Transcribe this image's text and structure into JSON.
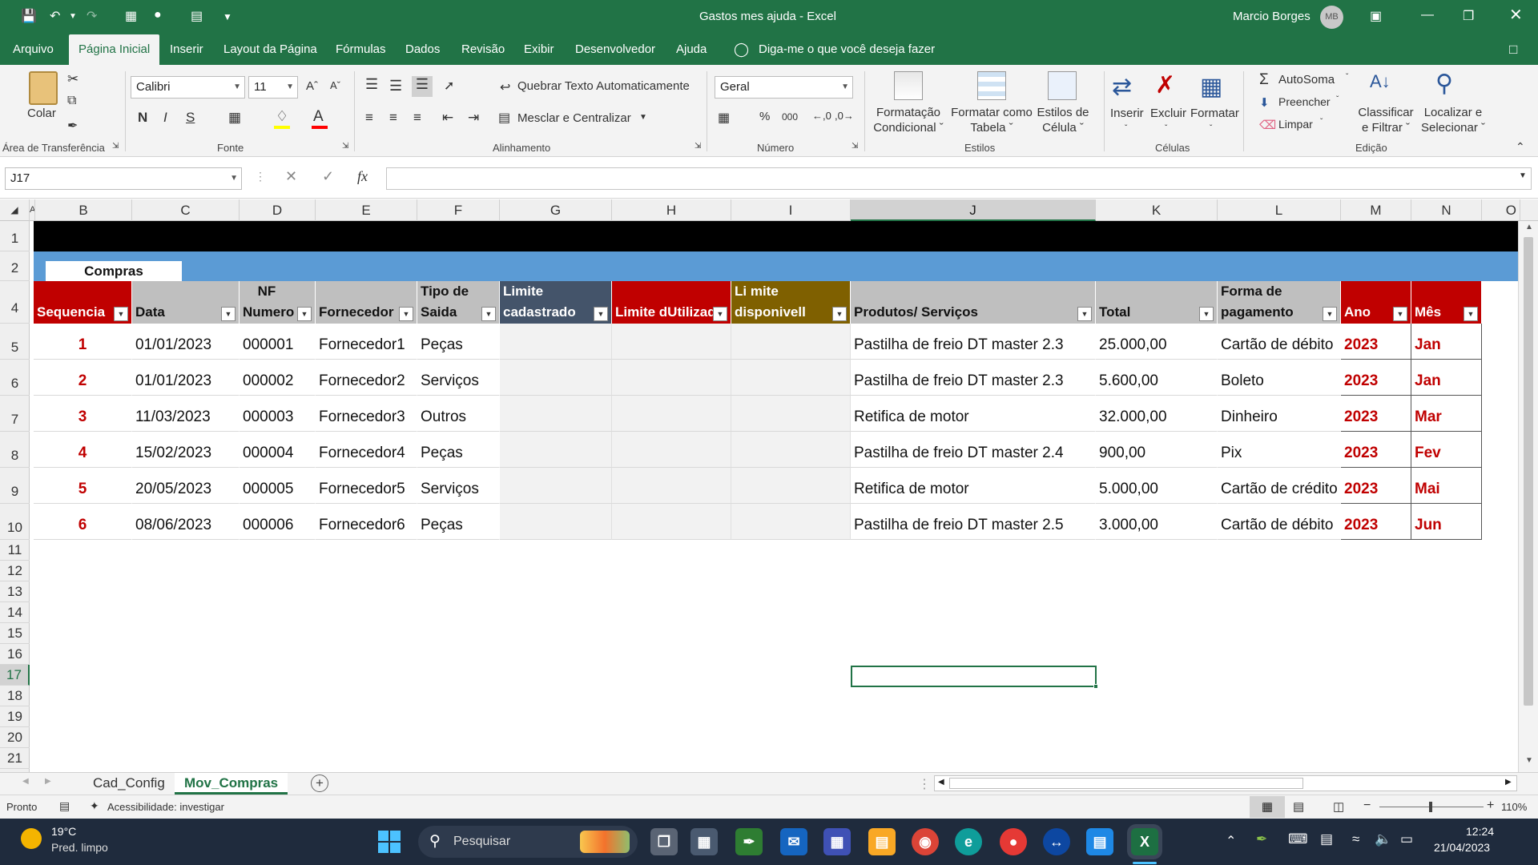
{
  "window": {
    "title": "Gastos mes ajuda  -  Excel",
    "user": "Marcio Borges",
    "user_initials": "MB"
  },
  "menu": {
    "tabs": [
      "Arquivo",
      "Página Inicial",
      "Inserir",
      "Layout da Página",
      "Fórmulas",
      "Dados",
      "Revisão",
      "Exibir",
      "Desenvolvedor",
      "Ajuda"
    ],
    "active_index": 1,
    "tell_me": "Diga-me o que você deseja fazer"
  },
  "ribbon": {
    "clipboard": {
      "paste": "Colar",
      "group": "Área de Transferência"
    },
    "font": {
      "name": "Calibri",
      "size": "11",
      "bold": "N",
      "italic": "I",
      "underline": "S",
      "color_letter": "A",
      "group": "Fonte"
    },
    "alignment": {
      "wrap": "Quebrar Texto Automaticamente",
      "merge": "Mesclar e Centralizar",
      "group": "Alinhamento"
    },
    "number": {
      "format": "Geral",
      "percent": "%",
      "thousands": "000",
      "group": "Número"
    },
    "styles": {
      "conditional": [
        "Formatação",
        "Condicional"
      ],
      "as_table": [
        "Formatar como",
        "Tabela"
      ],
      "cell_styles": [
        "Estilos de",
        "Célula"
      ],
      "group": "Estilos"
    },
    "cells": {
      "insert": "Inserir",
      "delete": "Excluir",
      "format": "Formatar",
      "group": "Células"
    },
    "editing": {
      "autosum": "AutoSoma",
      "fill": "Preencher",
      "clear": "Limpar",
      "sort": [
        "Classificar",
        "e Filtrar"
      ],
      "find": [
        "Localizar e",
        "Selecionar"
      ],
      "group": "Edição"
    }
  },
  "formula_bar": {
    "name_box": "J17",
    "formula": ""
  },
  "columns": [
    "A",
    "B",
    "C",
    "D",
    "E",
    "F",
    "G",
    "H",
    "I",
    "J",
    "K",
    "L",
    "M",
    "N",
    "O"
  ],
  "row_numbers": [
    "1",
    "2",
    "4",
    "5",
    "6",
    "7",
    "8",
    "9",
    "10",
    "11",
    "12",
    "13",
    "14",
    "15",
    "16",
    "17",
    "18",
    "19",
    "20",
    "21"
  ],
  "sheet": {
    "title_tab": "Compras",
    "headers": {
      "B": [
        "",
        "Sequencia"
      ],
      "C": [
        "",
        "Data"
      ],
      "D": [
        "NF",
        "Numero"
      ],
      "E": [
        "",
        "Fornecedor"
      ],
      "F": [
        "Tipo de",
        "Saida"
      ],
      "G": [
        "Limite",
        "cadastrado"
      ],
      "H": [
        "",
        "Limite dUtilizado"
      ],
      "I": [
        "Li mite",
        "disponivell"
      ],
      "J": [
        "",
        "Produtos/ Serviços"
      ],
      "K": [
        "",
        "Total"
      ],
      "L": [
        "Forma de",
        "pagamento"
      ],
      "M": [
        "",
        "Ano"
      ],
      "N": [
        "",
        "Mês"
      ]
    },
    "header_colors": {
      "default": "#c00000",
      "gray": "#bfbfbf",
      "G": "#44546a",
      "H": "#c00000",
      "I": "#7f6000"
    },
    "rows": [
      {
        "seq": "1",
        "data": "01/01/2023",
        "nf": "000001",
        "fornecedor": "Fornecedor1",
        "tipo": "Peças",
        "produto": "Pastilha de freio DT  master 2.3",
        "total": "25.000,00",
        "pagamento": "Cartão de débito",
        "ano": "2023",
        "mes": "Jan"
      },
      {
        "seq": "2",
        "data": "01/01/2023",
        "nf": "000002",
        "fornecedor": "Fornecedor2",
        "tipo": "Serviços",
        "produto": "Pastilha de freio DT  master 2.3",
        "total": "5.600,00",
        "pagamento": "Boleto",
        "ano": "2023",
        "mes": "Jan"
      },
      {
        "seq": "3",
        "data": "11/03/2023",
        "nf": "000003",
        "fornecedor": "Fornecedor3",
        "tipo": "Outros",
        "produto": "Retifica de motor",
        "total": "32.000,00",
        "pagamento": "Dinheiro",
        "ano": "2023",
        "mes": "Mar"
      },
      {
        "seq": "4",
        "data": "15/02/2023",
        "nf": "000004",
        "fornecedor": "Fornecedor4",
        "tipo": "Peças",
        "produto": "Pastilha de freio DT  master 2.4",
        "total": "900,00",
        "pagamento": "Pix",
        "ano": "2023",
        "mes": "Fev"
      },
      {
        "seq": "5",
        "data": "20/05/2023",
        "nf": "000005",
        "fornecedor": "Fornecedor5",
        "tipo": "Serviços",
        "produto": "Retifica de motor",
        "total": "5.000,00",
        "pagamento": "Cartão de crédito",
        "ano": "2023",
        "mes": "Mai"
      },
      {
        "seq": "6",
        "data": "08/06/2023",
        "nf": "000006",
        "fornecedor": "Fornecedor6",
        "tipo": "Peças",
        "produto": "Pastilha de freio DT  master 2.5",
        "total": "3.000,00",
        "pagamento": "Cartão de débito",
        "ano": "2023",
        "mes": "Jun"
      }
    ]
  },
  "sheet_tabs": [
    "Cad_Config",
    "Mov_Compras"
  ],
  "active_sheet": "Mov_Compras",
  "status": {
    "ready": "Pronto",
    "accessibility": "Acessibilidade: investigar",
    "zoom": "110%"
  },
  "taskbar": {
    "temp": "19°C",
    "weather": "Pred. limpo",
    "search": "Pesquisar",
    "time": "12:24",
    "date": "21/04/2023"
  },
  "colors": {
    "excel_green": "#217346",
    "red_text": "#c00000",
    "title_band": "#5b9bd5",
    "black_band": "#000000"
  }
}
